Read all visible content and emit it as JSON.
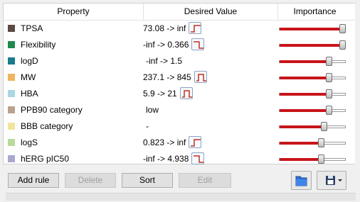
{
  "header": {
    "property": "Property",
    "desired_value": "Desired Value",
    "importance": "Importance"
  },
  "rows": [
    {
      "name": "TPSA",
      "value": "73.08 -> inf",
      "has_fn": true,
      "fn_type": "step-up",
      "swatch": "#5a4a42",
      "importance": 1.0
    },
    {
      "name": "Flexibility",
      "value": "-inf -> 0.366",
      "has_fn": true,
      "fn_type": "step-down",
      "swatch": "#1f8a4d",
      "importance": 1.0
    },
    {
      "name": "logD",
      "value": "-inf -> 1.5",
      "has_fn": false,
      "swatch": "#1a7b8c",
      "importance": 0.78
    },
    {
      "name": "MW",
      "value": "237.1 -> 845",
      "has_fn": true,
      "fn_type": "box",
      "swatch": "#f0b35e",
      "importance": 0.78
    },
    {
      "name": "HBA",
      "value": "5.9 -> 21",
      "has_fn": true,
      "fn_type": "box",
      "swatch": "#a8d8e0",
      "importance": 0.78
    },
    {
      "name": "PPB90 category",
      "value": "low",
      "has_fn": false,
      "swatch": "#b9a38e",
      "importance": 0.78
    },
    {
      "name": "BBB category",
      "value": "-",
      "has_fn": false,
      "swatch": "#f1e59c",
      "importance": 0.7
    },
    {
      "name": "logS",
      "value": "0.823 -> inf",
      "has_fn": true,
      "fn_type": "step-up",
      "swatch": "#b9d99a",
      "importance": 0.66
    },
    {
      "name": "hERG pIC50",
      "value": "-inf -> 4.938",
      "has_fn": true,
      "fn_type": "step-down",
      "swatch": "#a9a8cf",
      "importance": 0.66
    }
  ],
  "buttons": {
    "add_rule": "Add rule",
    "delete": "Delete",
    "sort": "Sort",
    "edit": "Edit"
  },
  "icons": {
    "open": "folder-open-icon",
    "save": "floppy-disk-dropdown-icon"
  },
  "colors": {
    "importance_fill": "#c8141a"
  }
}
